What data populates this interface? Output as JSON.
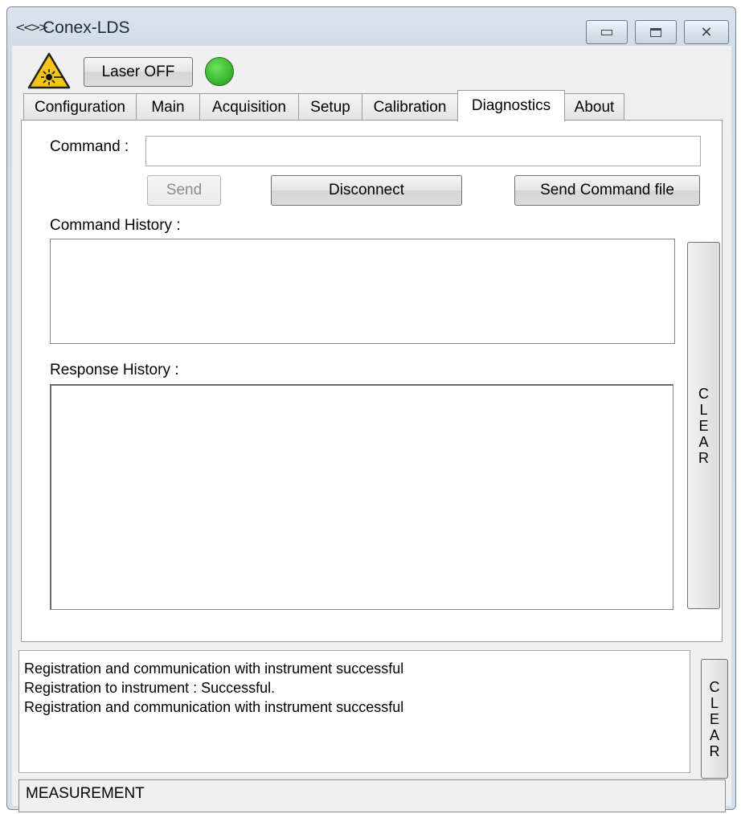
{
  "window": {
    "title": "Conex-LDS",
    "icon": "conex-logo-icon"
  },
  "toolbar": {
    "warning_icon": "laser-warning-icon",
    "laser_button": "Laser OFF",
    "status_led_color": "#3cb832"
  },
  "tabs": [
    {
      "label": "Configuration",
      "active": false
    },
    {
      "label": "Main",
      "active": false
    },
    {
      "label": "Acquisition",
      "active": false
    },
    {
      "label": "Setup",
      "active": false
    },
    {
      "label": "Calibration",
      "active": false
    },
    {
      "label": "Diagnostics",
      "active": true
    },
    {
      "label": "About",
      "active": false
    }
  ],
  "diagnostics": {
    "command_label": "Command :",
    "command_value": "",
    "send_button": "Send",
    "disconnect_button": "Disconnect",
    "send_file_button": "Send Command file",
    "command_history_label": "Command History :",
    "response_history_label": "Response History :",
    "clear_button": [
      "C",
      "L",
      "E",
      "A",
      "R"
    ]
  },
  "log": {
    "lines": [
      "Registration and communication with instrument successful",
      "Registration to instrument : Successful.",
      "Registration and communication with instrument successful"
    ],
    "clear_button": [
      "C",
      "L",
      "E",
      "A",
      "R"
    ]
  },
  "status": {
    "text": "MEASUREMENT"
  }
}
